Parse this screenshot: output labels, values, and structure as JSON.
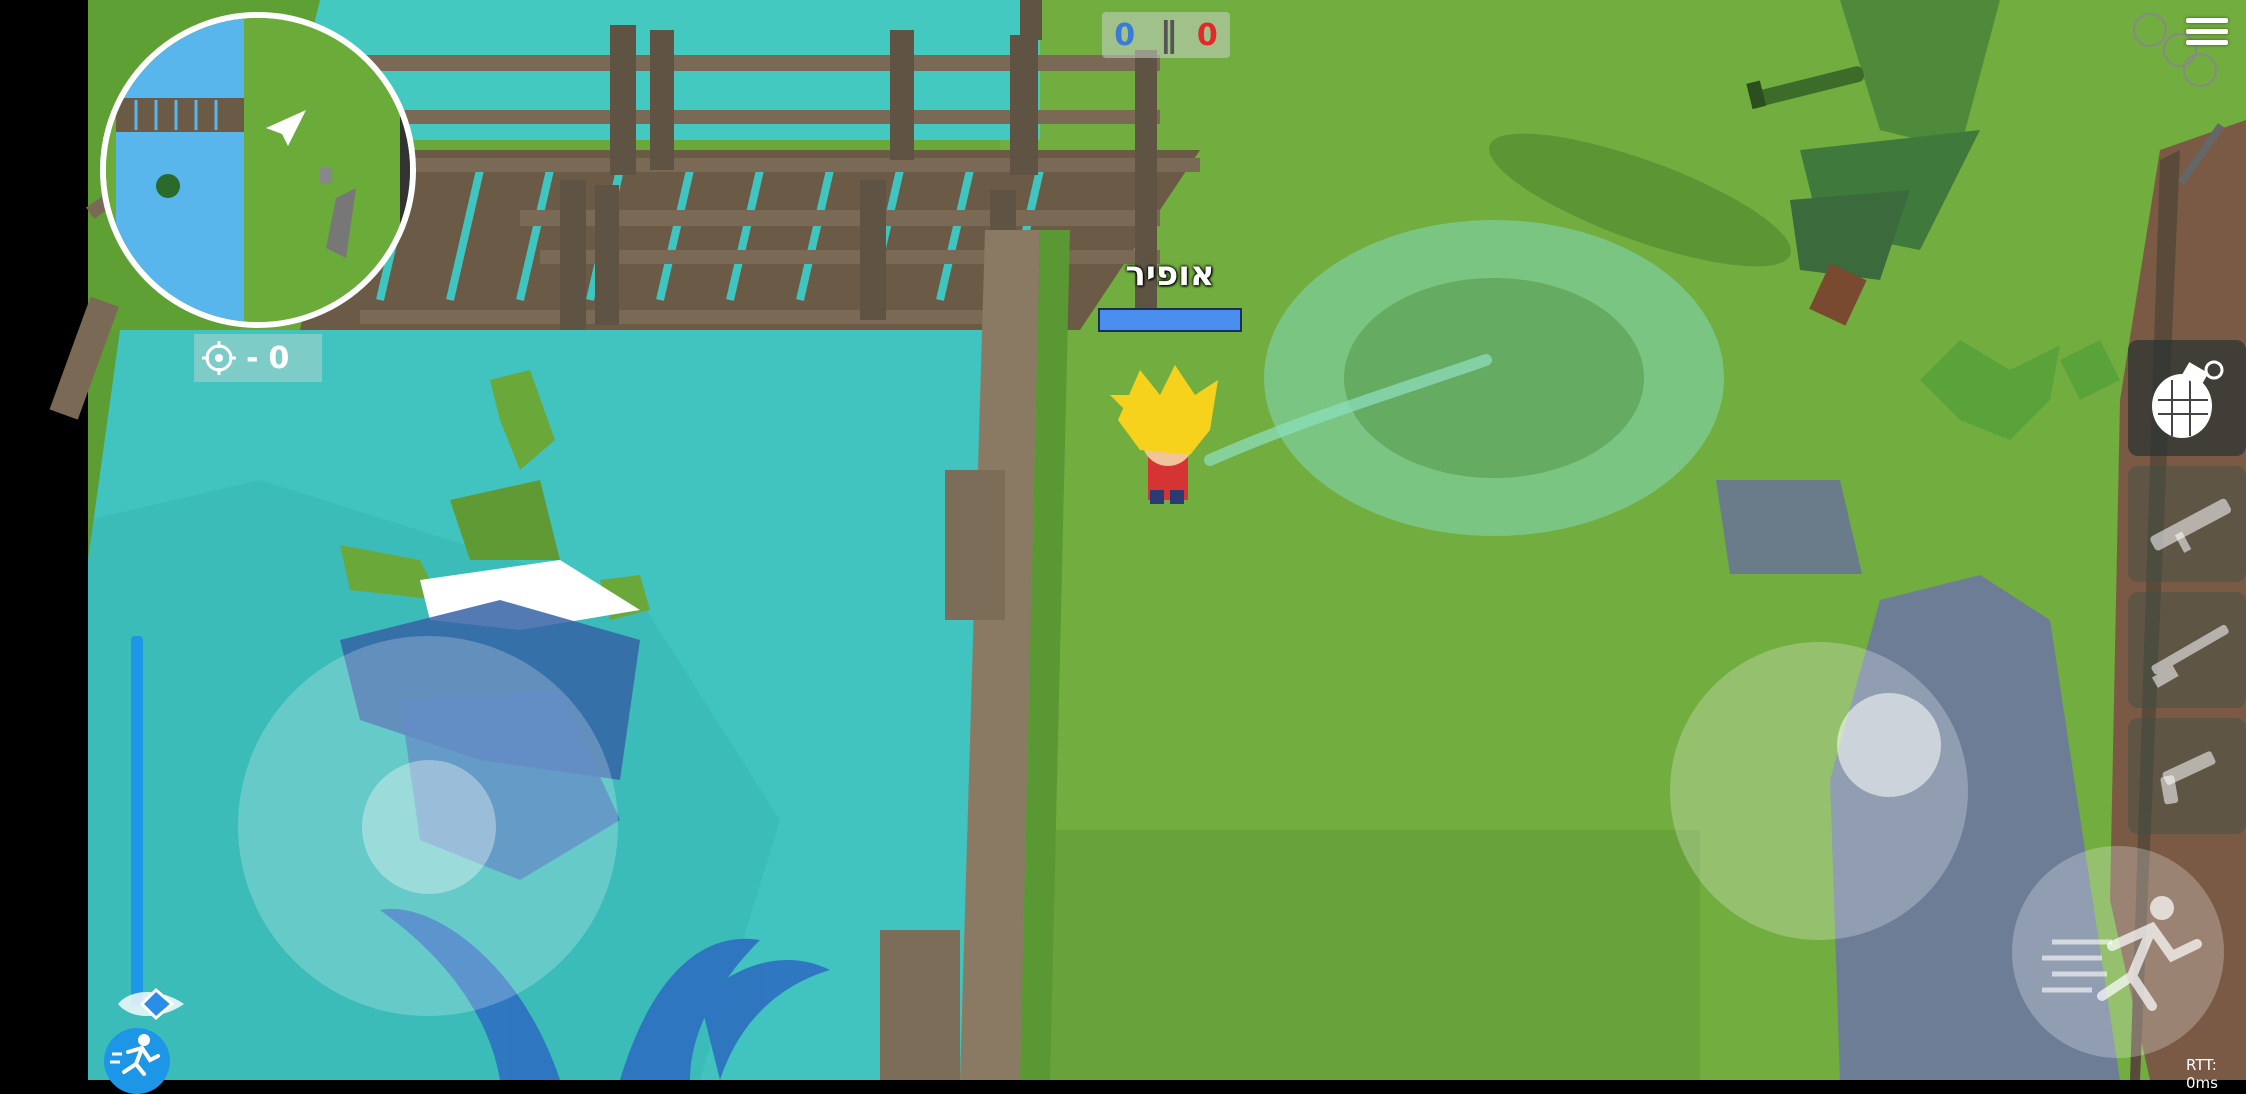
{
  "hud": {
    "score_blue": "0",
    "score_separator": "||",
    "score_red": "0",
    "player_name": "אופיר",
    "health_fraction": 1.0,
    "kills_dash": "-",
    "kills_count": "0",
    "rtt": "RTT: 0ms"
  },
  "weapons": [
    {
      "icon": "grenade-icon",
      "active": true
    },
    {
      "icon": "rocket-launcher-icon",
      "active": false
    },
    {
      "icon": "shotgun-icon",
      "active": false
    },
    {
      "icon": "pistol-icon",
      "active": false
    }
  ],
  "colors": {
    "grass": "#6aa83a",
    "water": "#3ec8c0",
    "team_blue": "#3a7bd5",
    "team_red": "#e02a2a"
  }
}
